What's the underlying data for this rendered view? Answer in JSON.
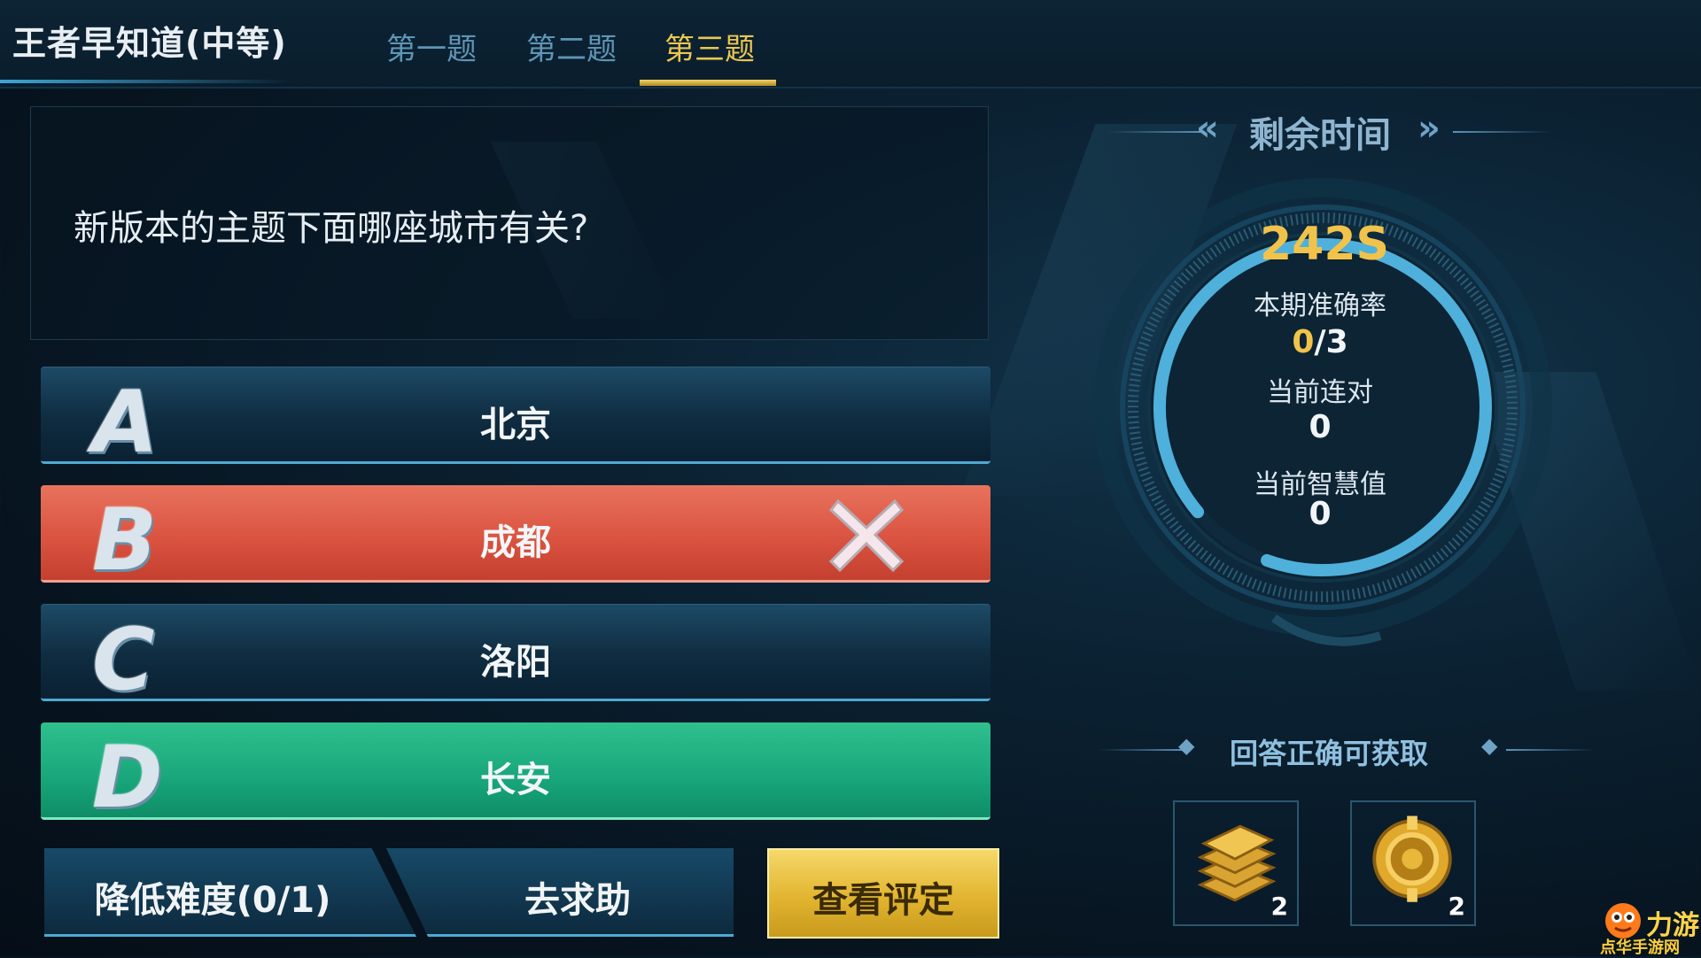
{
  "header": {
    "title": "王者早知道(中等)",
    "tabs": [
      {
        "label": "第一题",
        "active": false
      },
      {
        "label": "第二题",
        "active": false
      },
      {
        "label": "第三题",
        "active": true
      }
    ]
  },
  "question": {
    "text": "新版本的主题下面哪座城市有关?"
  },
  "options": [
    {
      "letter": "A",
      "text": "北京",
      "state": "normal"
    },
    {
      "letter": "B",
      "text": "成都",
      "state": "wrong"
    },
    {
      "letter": "C",
      "text": "洛阳",
      "state": "normal"
    },
    {
      "letter": "D",
      "text": "长安",
      "state": "correct"
    }
  ],
  "buttons": {
    "lower_difficulty": "降低难度(0/1)",
    "seek_help": "去求助",
    "view_rating": "查看评定"
  },
  "timer": {
    "header": "剩余时间",
    "value": "242S"
  },
  "stats": {
    "accuracy_label": "本期准确率",
    "accuracy_correct": "0",
    "accuracy_total": "/3",
    "streak_label": "当前连对",
    "streak_value": "0",
    "wisdom_label": "当前智慧值",
    "wisdom_value": "0"
  },
  "rewards": {
    "header": "回答正确可获取",
    "items": [
      {
        "icon": "coin-stack-icon",
        "count": "2"
      },
      {
        "icon": "gold-medal-icon",
        "count": "2"
      }
    ]
  },
  "watermark": {
    "brand": "力游",
    "sub": "点华手游网"
  },
  "colors": {
    "accent_gold": "#f1c34a",
    "wrong_red": "#d9513f",
    "correct_green": "#18a67a",
    "option_blue": "#0f2c40"
  }
}
